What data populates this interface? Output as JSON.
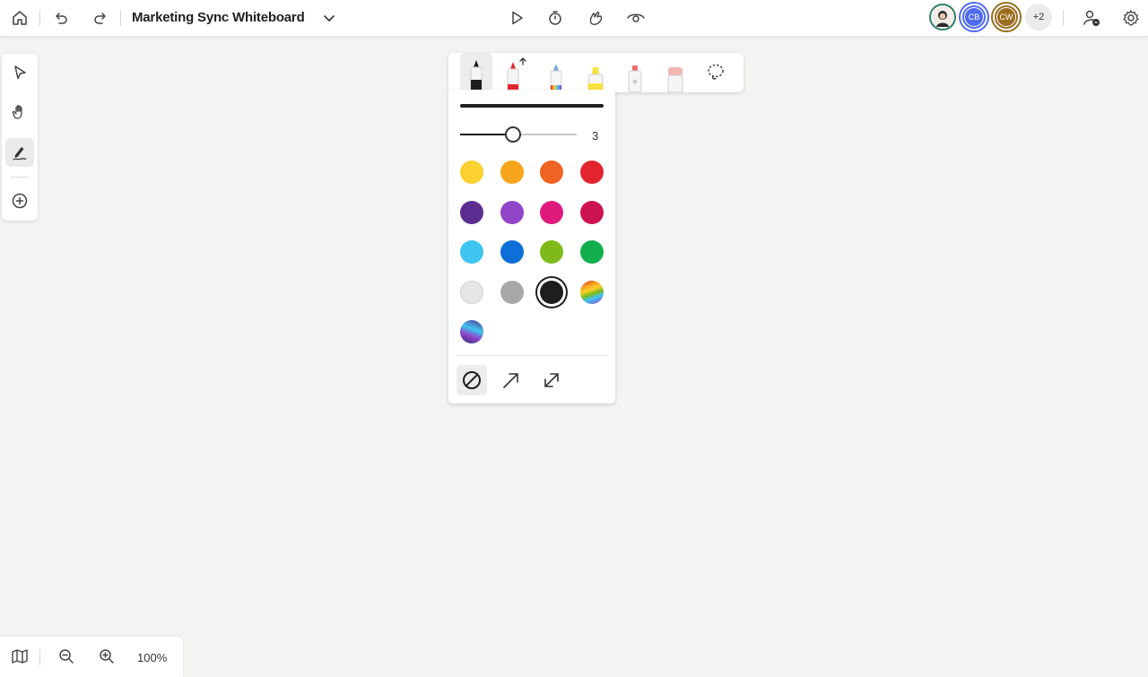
{
  "header": {
    "title": "Marketing Sync Whiteboard",
    "icons": [
      "home-icon",
      "undo-icon",
      "redo-icon",
      "chevron-down-icon",
      "play-icon",
      "timer-icon",
      "reaction-icon",
      "eye-icon",
      "share-people-icon",
      "settings-icon"
    ],
    "avatars": [
      {
        "initials": "",
        "color": "#2e7d6b"
      },
      {
        "initials": "CB",
        "color": "#4f6bed"
      },
      {
        "initials": "CW",
        "color": "#9a6d1f"
      }
    ],
    "more_count": "+2"
  },
  "left_toolbar": {
    "tools": [
      "select-pointer-icon",
      "hand-pan-icon",
      "pen-ink-icon",
      "add-icon"
    ],
    "active": "pen-ink-icon"
  },
  "pen_tray": {
    "tools": [
      {
        "name": "pen-black",
        "tip": "#1e1e1e"
      },
      {
        "name": "pen-red-arrow",
        "tip": "#e3262f"
      },
      {
        "name": "pen-rainbow",
        "tip": "#6fa8dc"
      },
      {
        "name": "highlighter-yellow",
        "tip": "#f6e33c"
      },
      {
        "name": "laser-pointer",
        "tip": "#f26d6d"
      },
      {
        "name": "eraser",
        "tip": "#f3b5b5"
      },
      {
        "name": "lasso-select",
        "tip": "#333333"
      }
    ]
  },
  "ink_panel": {
    "thickness_value": "3",
    "thickness_fraction": 0.45,
    "colors": [
      "#fcd130",
      "#f7a51d",
      "#f06323",
      "#e3232d",
      "#5c2d91",
      "#9244c9",
      "#e0197d",
      "#cc1250",
      "#3ec4f0",
      "#0f6fd8",
      "#7fba1b",
      "#12b04c",
      "#e6e6e6",
      "#a8a8a8",
      "#1e1e1e",
      "rainbow",
      "galaxy"
    ],
    "selected_color_index": 14,
    "line_ends": [
      "no-arrow-icon",
      "arrow-end-icon",
      "arrow-both-icon"
    ],
    "selected_end": 0
  },
  "bottom_bar": {
    "zoom_level": "100%",
    "icons": [
      "map-icon",
      "zoom-out-icon",
      "zoom-in-icon"
    ]
  }
}
